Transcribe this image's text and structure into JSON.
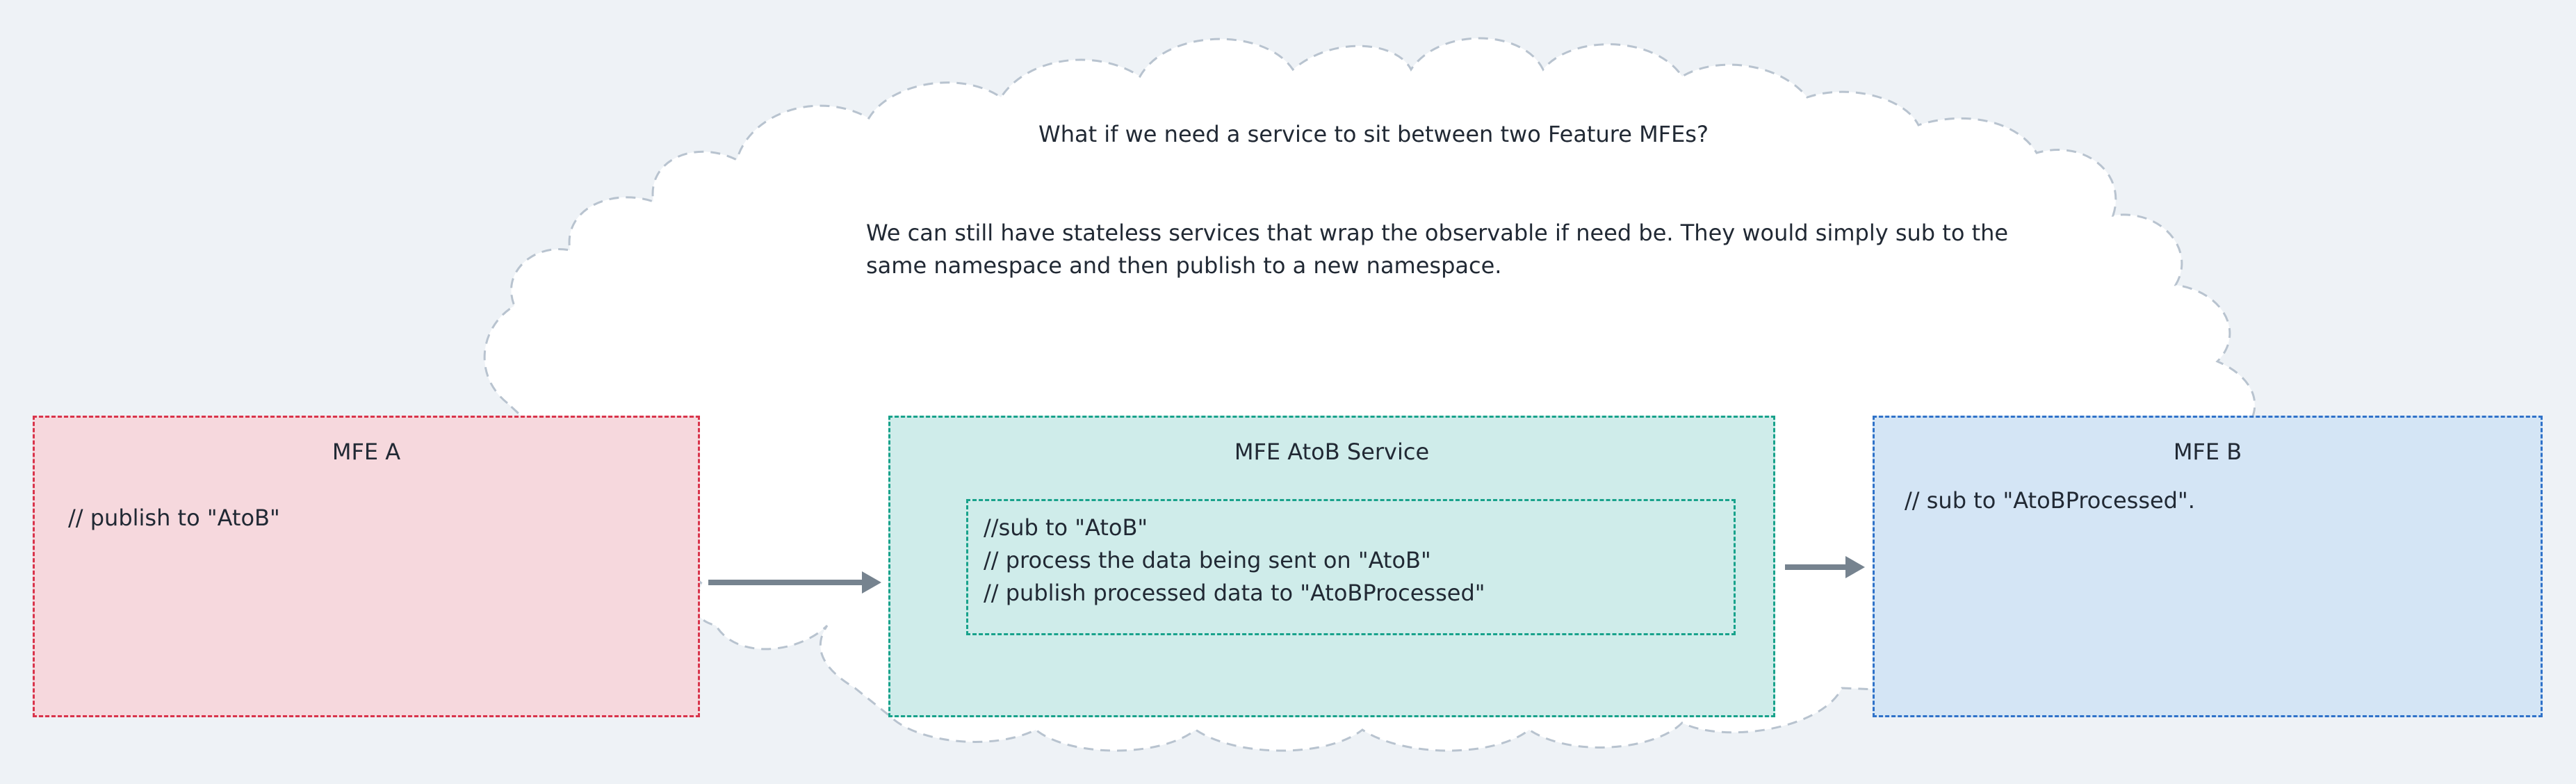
{
  "cloud": {
    "question": "What if we need a service to sit between two Feature MFEs?",
    "explanation_lines": [
      "We can still have stateless services that wrap the observable if need be. They would simply sub to the",
      "same namespace and then publish to a new namespace."
    ]
  },
  "mfe_a": {
    "title": "MFE A",
    "note": "// publish to \"AtoB\""
  },
  "mfe_atob_service": {
    "title": "MFE AtoB Service",
    "lines": [
      "//sub to \"AtoB\"",
      "// process the data being sent on \"AtoB\"",
      "// publish processed data to \"AtoBProcessed\""
    ]
  },
  "mfe_b": {
    "title": "MFE B",
    "note": "// sub to \"AtoBProcessed\"."
  },
  "colors": {
    "background": "#eef2f6",
    "mfe_a_fill": "#f6d8dd",
    "mfe_a_border": "#d9344b",
    "service_fill": "#cfecea",
    "service_border": "#18a28b",
    "mfe_b_fill": "#d4e5f5",
    "mfe_b_border": "#2f72c9",
    "arrow": "#76838f",
    "cloud_border": "#b8c3cf"
  }
}
